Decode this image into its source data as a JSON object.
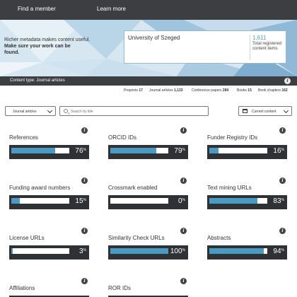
{
  "nav": {
    "find_member": "Find a member",
    "learn_more": "Learn more"
  },
  "hero": {
    "line1": "Richer metadata makes content useful.",
    "line2": "Make sure your work can be",
    "line3": "found."
  },
  "member": {
    "name": "University of Szeged",
    "total_count": "1,611",
    "total_label": "Total registered content items"
  },
  "content_type": {
    "label": "Content type: Journal articles"
  },
  "counts": [
    {
      "label": "Preprints",
      "value": "17"
    },
    {
      "label": "Journal articles",
      "value": "1,133"
    },
    {
      "label": "Conference papers",
      "value": "284"
    },
    {
      "label": "Books",
      "value": "15"
    },
    {
      "label": "Book chapters",
      "value": "162"
    }
  ],
  "toolbar": {
    "type_select": "Journal articles",
    "search_placeholder": "Search by title",
    "period_select": "Current content"
  },
  "metrics": [
    {
      "label": "References",
      "percent": 76,
      "unit": "%"
    },
    {
      "label": "ORCID IDs",
      "percent": 79,
      "unit": "%"
    },
    {
      "label": "Funder Registry IDs",
      "percent": 16,
      "unit": "%"
    },
    {
      "label": "Funding award numbers",
      "percent": 15,
      "unit": "%"
    },
    {
      "label": "Crossmark enabled",
      "percent": 0,
      "unit": "%"
    },
    {
      "label": "Text mining URLs",
      "percent": 83,
      "unit": "%"
    },
    {
      "label": "License URLs",
      "percent": 3,
      "unit": "%"
    },
    {
      "label": "Similarity Check URLs",
      "percent": 100,
      "unit": "%"
    },
    {
      "label": "Abstracts",
      "percent": 94,
      "unit": "%"
    },
    {
      "label": "Affiliations",
      "percent": null,
      "unit": ""
    },
    {
      "label": "ROR IDs",
      "percent": null,
      "unit": ""
    }
  ],
  "colors": {
    "nav_bg": "#3c3e42",
    "bar_fill": "#4a9bc4",
    "metric_box": "#2f3134",
    "count_accent": "#4aa3c9"
  }
}
